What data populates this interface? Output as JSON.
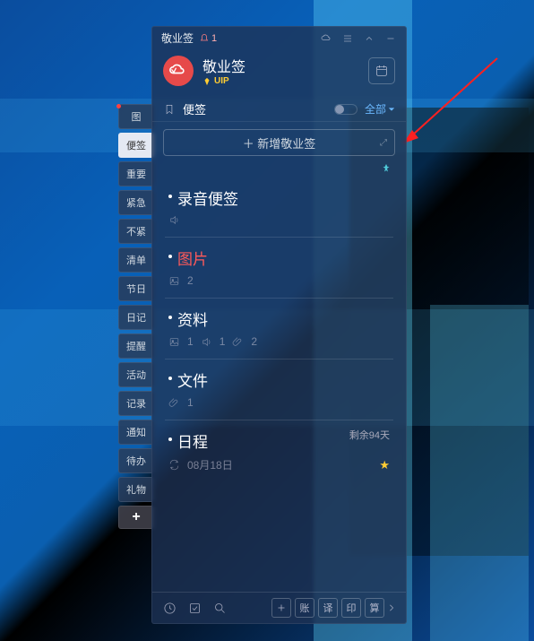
{
  "titlebar": {
    "app_name": "敬业签",
    "notify_count": "1"
  },
  "header": {
    "title": "敬业签",
    "vip_label": "UIP"
  },
  "tabs": {
    "note_label": "便签",
    "filter_label": "全部"
  },
  "new_note_label": "＋ 新增敬业签",
  "side_tabs": [
    "图",
    "便签",
    "重要",
    "紧急",
    "不紧",
    "清单",
    "节日",
    "日记",
    "提醒",
    "活动",
    "记录",
    "通知",
    "待办",
    "礼物"
  ],
  "notes": [
    {
      "title": "录音便签",
      "title_red": false,
      "audio": true,
      "image_count": null,
      "attach_count": null,
      "has_recur": false,
      "badge": null,
      "date": null,
      "star": false
    },
    {
      "title": "图片",
      "title_red": true,
      "audio": false,
      "image_count": "2",
      "attach_count": null,
      "has_recur": false,
      "badge": null,
      "date": null,
      "star": false
    },
    {
      "title": "资料",
      "title_red": false,
      "audio": true,
      "image_count": "1",
      "attach_count": "2",
      "has_recur": false,
      "badge": null,
      "date": null,
      "star": false
    },
    {
      "title": "文件",
      "title_red": false,
      "audio": false,
      "image_count": null,
      "attach_count": "1",
      "has_recur": false,
      "badge": null,
      "date": null,
      "star": false
    },
    {
      "title": "日程",
      "title_red": false,
      "audio": false,
      "image_count": null,
      "attach_count": null,
      "has_recur": true,
      "badge": "剩余94天",
      "date": "08月18日",
      "star": true
    }
  ],
  "footer_chips": [
    "账",
    "译",
    "印",
    "算"
  ]
}
